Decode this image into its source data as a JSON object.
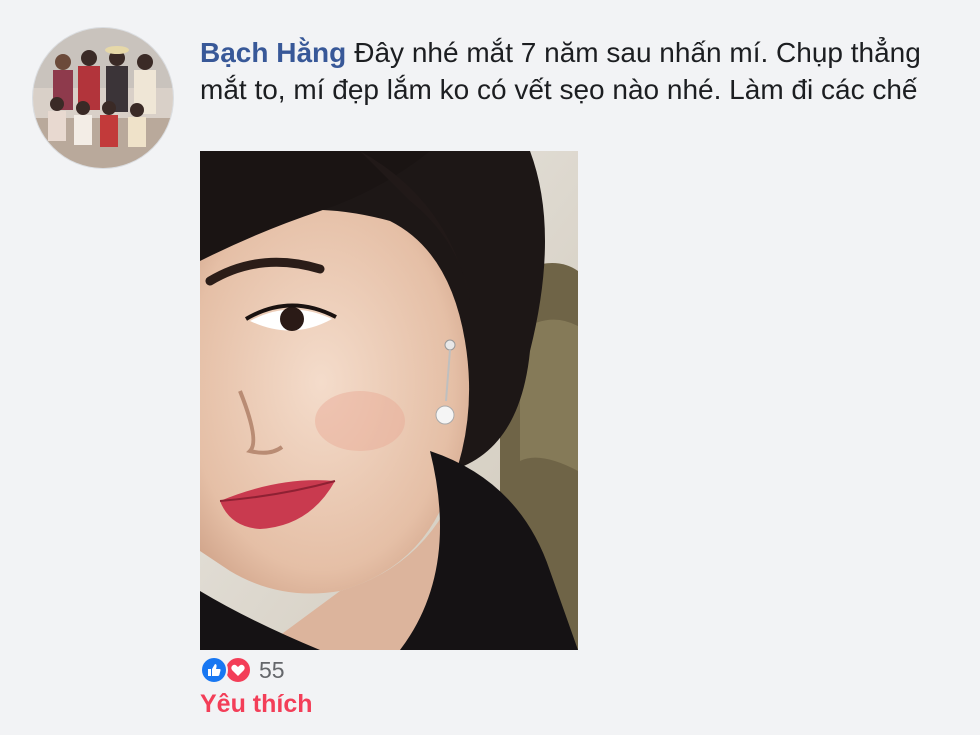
{
  "comment": {
    "author": "Bạch Hằng",
    "text": "Đây nhé mắt 7 năm sau nhấn mí. Chụp thẳng mắt to, mí đẹp lắm ko có vết sẹo nào nhé. Làm đi các chế",
    "reactions": {
      "icons": [
        "like-icon",
        "love-icon"
      ],
      "count": "55"
    },
    "action_label": "Yêu thích"
  },
  "colors": {
    "author": "#385898",
    "like": "#1877f2",
    "love": "#f33e58",
    "background": "#f2f3f5"
  }
}
